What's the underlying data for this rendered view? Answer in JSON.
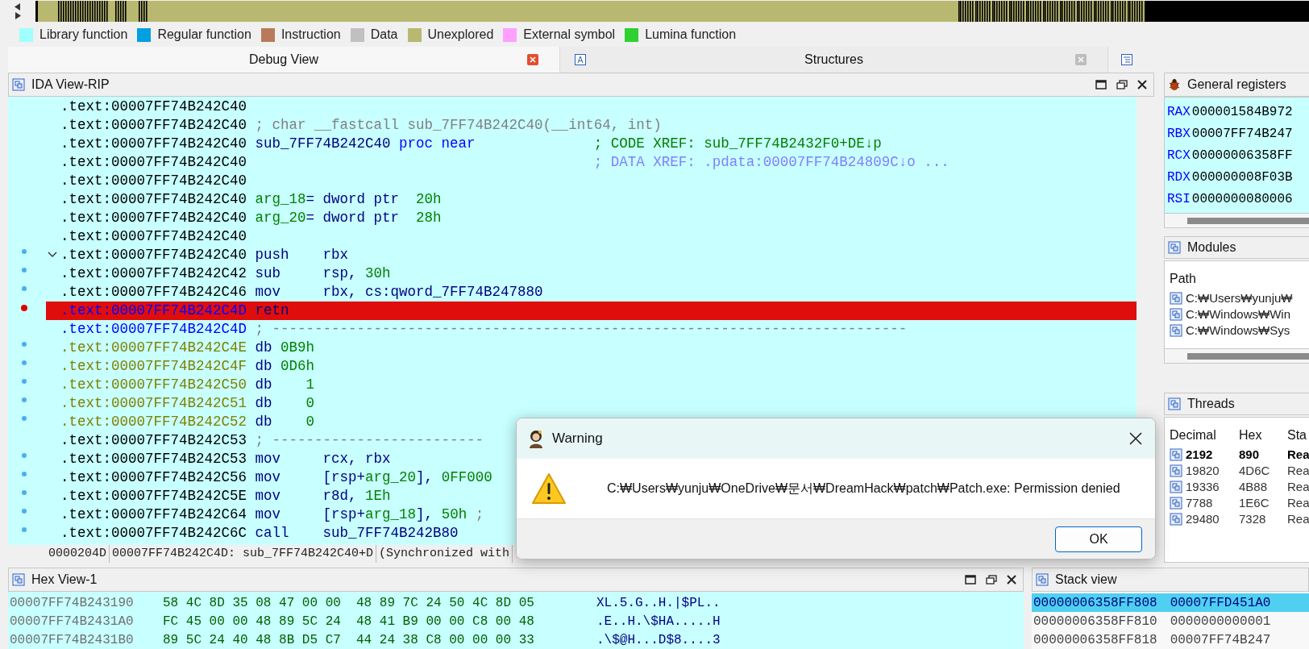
{
  "legend": [
    {
      "label": "Library function",
      "color": "#a0ffff"
    },
    {
      "label": "Regular function",
      "color": "#00a0e0"
    },
    {
      "label": "Instruction",
      "color": "#b87a5a"
    },
    {
      "label": "Data",
      "color": "#c0c0c0"
    },
    {
      "label": "Unexplored",
      "color": "#b8b870"
    },
    {
      "label": "External symbol",
      "color": "#ffa0ff"
    },
    {
      "label": "Lumina function",
      "color": "#30d030"
    }
  ],
  "tabs": [
    {
      "label": "Debug View",
      "selected": true
    },
    {
      "label": "Structures",
      "selected": false
    }
  ],
  "ida_view": {
    "title": "IDA View-RIP",
    "lines": [
      {
        "address": ".text:00007FF74B242C40",
        "kind": "normal",
        "dot": false,
        "breakpoint": false,
        "expanded": false
      },
      {
        "address": ".text:00007FF74B242C40",
        "kind": "normal",
        "dot": false,
        "breakpoint": false,
        "expanded": false,
        "segments": [
          {
            "text": "; char __fastcall sub_7FF74B242C40(__int64, int)",
            "kind": "comment"
          }
        ]
      },
      {
        "address": ".text:00007FF74B242C40",
        "kind": "normal",
        "dot": false,
        "breakpoint": false,
        "expanded": false,
        "segments": [
          {
            "text": "sub_7FF74B242C40",
            "kind": "name"
          },
          {
            "text": " proc near",
            "kind": "keyword"
          },
          {
            "text": "              ; CODE XREF: sub_7FF74B2432F0+DE↓p",
            "kind": "xref"
          }
        ]
      },
      {
        "address": ".text:00007FF74B242C40",
        "kind": "normal",
        "dot": false,
        "breakpoint": false,
        "expanded": false,
        "segments": [
          {
            "text": "                                        ; DATA XREF: .pdata:00007FF74B24809C↓o ...",
            "kind": "dataxref"
          }
        ]
      },
      {
        "address": ".text:00007FF74B242C40",
        "kind": "normal",
        "dot": false,
        "breakpoint": false,
        "expanded": false
      },
      {
        "address": ".text:00007FF74B242C40",
        "kind": "normal",
        "dot": false,
        "breakpoint": false,
        "expanded": false,
        "segments": [
          {
            "text": "arg_18",
            "kind": "var"
          },
          {
            "text": "= dword ptr  ",
            "kind": "name"
          },
          {
            "text": "20h",
            "kind": "num"
          }
        ]
      },
      {
        "address": ".text:00007FF74B242C40",
        "kind": "normal",
        "dot": false,
        "breakpoint": false,
        "expanded": false,
        "segments": [
          {
            "text": "arg_20",
            "kind": "var"
          },
          {
            "text": "= dword ptr  ",
            "kind": "name"
          },
          {
            "text": "28h",
            "kind": "num"
          }
        ]
      },
      {
        "address": ".text:00007FF74B242C40",
        "kind": "normal",
        "dot": false,
        "breakpoint": false,
        "expanded": false
      },
      {
        "address": ".text:00007FF74B242C40",
        "kind": "normal",
        "dot": true,
        "breakpoint": false,
        "expanded": true,
        "segments": [
          {
            "text": "push    rbx",
            "kind": "name"
          }
        ]
      },
      {
        "address": ".text:00007FF74B242C42",
        "kind": "normal",
        "dot": true,
        "breakpoint": false,
        "expanded": false,
        "segments": [
          {
            "text": "sub     rsp, ",
            "kind": "name"
          },
          {
            "text": "30h",
            "kind": "num"
          }
        ]
      },
      {
        "address": ".text:00007FF74B242C46",
        "kind": "normal",
        "dot": true,
        "breakpoint": false,
        "expanded": false,
        "segments": [
          {
            "text": "mov     rbx, cs:qword_7FF74B247880",
            "kind": "name"
          }
        ]
      },
      {
        "address": ".text:00007FF74B242C4D",
        "kind": "current",
        "dot": false,
        "breakpoint": true,
        "expanded": false,
        "segments": [
          {
            "text": "retn",
            "kind": "name"
          }
        ]
      },
      {
        "address": ".text:00007FF74B242C4D",
        "kind": "current",
        "dot": false,
        "breakpoint": false,
        "expanded": false,
        "segments": [
          {
            "text": "; ---------------------------------------------------------------------------",
            "kind": "comment"
          }
        ]
      },
      {
        "address": ".text:00007FF74B242C4E",
        "kind": "data",
        "dot": true,
        "breakpoint": false,
        "expanded": false,
        "segments": [
          {
            "text": "db ",
            "kind": "name"
          },
          {
            "text": "0B9h",
            "kind": "num"
          }
        ]
      },
      {
        "address": ".text:00007FF74B242C4F",
        "kind": "data",
        "dot": true,
        "breakpoint": false,
        "expanded": false,
        "segments": [
          {
            "text": "db ",
            "kind": "name"
          },
          {
            "text": "0D6h",
            "kind": "num"
          }
        ]
      },
      {
        "address": ".text:00007FF74B242C50",
        "kind": "data",
        "dot": true,
        "breakpoint": false,
        "expanded": false,
        "segments": [
          {
            "text": "db    ",
            "kind": "name"
          },
          {
            "text": "1",
            "kind": "num"
          }
        ]
      },
      {
        "address": ".text:00007FF74B242C51",
        "kind": "data",
        "dot": true,
        "breakpoint": false,
        "expanded": false,
        "segments": [
          {
            "text": "db    ",
            "kind": "name"
          },
          {
            "text": "0",
            "kind": "num"
          }
        ]
      },
      {
        "address": ".text:00007FF74B242C52",
        "kind": "data",
        "dot": true,
        "breakpoint": false,
        "expanded": false,
        "segments": [
          {
            "text": "db    ",
            "kind": "name"
          },
          {
            "text": "0",
            "kind": "num"
          }
        ]
      },
      {
        "address": ".text:00007FF74B242C53",
        "kind": "normal",
        "dot": false,
        "breakpoint": false,
        "expanded": false,
        "segments": [
          {
            "text": "; -------------------------",
            "kind": "comment"
          }
        ]
      },
      {
        "address": ".text:00007FF74B242C53",
        "kind": "normal",
        "dot": true,
        "breakpoint": false,
        "expanded": false,
        "segments": [
          {
            "text": "mov     rcx, rbx",
            "kind": "name"
          }
        ]
      },
      {
        "address": ".text:00007FF74B242C56",
        "kind": "normal",
        "dot": true,
        "breakpoint": false,
        "expanded": false,
        "segments": [
          {
            "text": "mov     [rsp+",
            "kind": "name"
          },
          {
            "text": "arg_20",
            "kind": "var"
          },
          {
            "text": "], ",
            "kind": "name"
          },
          {
            "text": "0FF000",
            "kind": "num"
          }
        ]
      },
      {
        "address": ".text:00007FF74B242C5E",
        "kind": "normal",
        "dot": true,
        "breakpoint": false,
        "expanded": false,
        "segments": [
          {
            "text": "mov     r8d, ",
            "kind": "name"
          },
          {
            "text": "1Eh",
            "kind": "num"
          }
        ]
      },
      {
        "address": ".text:00007FF74B242C64",
        "kind": "normal",
        "dot": true,
        "breakpoint": false,
        "expanded": false,
        "segments": [
          {
            "text": "mov     [rsp+",
            "kind": "name"
          },
          {
            "text": "arg_18",
            "kind": "var"
          },
          {
            "text": "], ",
            "kind": "name"
          },
          {
            "text": "50h",
            "kind": "num"
          },
          {
            "text": " ;",
            "kind": "comment"
          }
        ]
      },
      {
        "address": ".text:00007FF74B242C6C",
        "kind": "normal",
        "dot": true,
        "breakpoint": false,
        "expanded": false,
        "segments": [
          {
            "text": "call    sub_7FF74B242B80",
            "kind": "name"
          }
        ]
      }
    ],
    "status": [
      "0000204D",
      "00007FF74B242C4D: sub_7FF74B242C40+D",
      "(Synchronized with"
    ]
  },
  "registers": {
    "title": "General registers",
    "rows": [
      {
        "name": "RAX",
        "value": "000001584B972"
      },
      {
        "name": "RBX",
        "value": "00007FF74B247"
      },
      {
        "name": "RCX",
        "value": "00000006358FF"
      },
      {
        "name": "RDX",
        "value": "000000008F03B"
      },
      {
        "name": "RSI",
        "value": "0000000080006"
      }
    ]
  },
  "modules": {
    "title": "Modules",
    "header": "Path",
    "rows": [
      "C:₩Users₩yunju₩",
      "C:₩Windows₩Win",
      "C:₩Windows₩Sys"
    ]
  },
  "threads": {
    "title": "Threads",
    "columns": [
      "Decimal",
      "Hex",
      "Sta"
    ],
    "rows": [
      {
        "cells": [
          "2192",
          "890",
          "Rea"
        ],
        "current": true
      },
      {
        "cells": [
          "19820",
          "4D6C",
          "Rea"
        ],
        "current": false
      },
      {
        "cells": [
          "19336",
          "4B88",
          "Rea"
        ],
        "current": false
      },
      {
        "cells": [
          "7788",
          "1E6C",
          "Rea"
        ],
        "current": false
      },
      {
        "cells": [
          "29480",
          "7328",
          "Rea"
        ],
        "current": false
      }
    ]
  },
  "hex_view": {
    "title": "Hex View-1",
    "rows": [
      {
        "address": "00007FF74B243190",
        "bytes1": "58 4C 8D 35 08 47 00 00",
        "bytes2": "48 89 7C 24 50 4C 8D 05",
        "ascii": "XL.5.G..H.|$PL.."
      },
      {
        "address": "00007FF74B2431A0",
        "bytes1": "FC 45 00 00 48 89 5C 24",
        "bytes2": "48 41 B9 00 00 C8 00 48",
        "ascii": ".E..H.\\$HA.....H"
      },
      {
        "address": "00007FF74B2431B0",
        "bytes1": "89 5C 24 40 48 8B D5 C7",
        "bytes2": "44 24 38 C8 00 00 00 33",
        "ascii": ".\\$@H...D$8....3"
      }
    ]
  },
  "stack_view": {
    "title": "Stack view",
    "rows": [
      {
        "address": "00000006358FF808",
        "value": "00007FFD451A0",
        "selected": true
      },
      {
        "address": "00000006358FF810",
        "value": "0000000000001",
        "selected": false
      },
      {
        "address": "00000006358FF818",
        "value": "00007FF74B247",
        "selected": false
      }
    ]
  },
  "dialog": {
    "title": "Warning",
    "message": "C:₩Users₩yunju₩OneDrive₩문서₩DreamHack₩patch₩Patch.exe: Permission denied",
    "button": "OK"
  }
}
